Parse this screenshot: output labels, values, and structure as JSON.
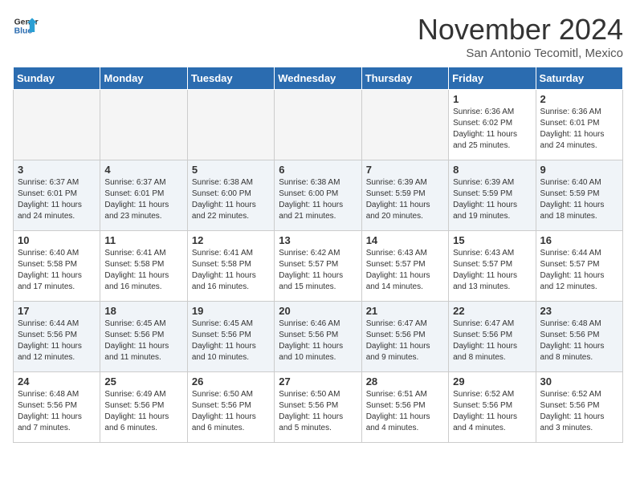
{
  "header": {
    "logo_line1": "General",
    "logo_line2": "Blue",
    "month_title": "November 2024",
    "location": "San Antonio Tecomitl, Mexico"
  },
  "weekdays": [
    "Sunday",
    "Monday",
    "Tuesday",
    "Wednesday",
    "Thursday",
    "Friday",
    "Saturday"
  ],
  "weeks": [
    [
      {
        "day": "",
        "info": ""
      },
      {
        "day": "",
        "info": ""
      },
      {
        "day": "",
        "info": ""
      },
      {
        "day": "",
        "info": ""
      },
      {
        "day": "",
        "info": ""
      },
      {
        "day": "1",
        "info": "Sunrise: 6:36 AM\nSunset: 6:02 PM\nDaylight: 11 hours\nand 25 minutes."
      },
      {
        "day": "2",
        "info": "Sunrise: 6:36 AM\nSunset: 6:01 PM\nDaylight: 11 hours\nand 24 minutes."
      }
    ],
    [
      {
        "day": "3",
        "info": "Sunrise: 6:37 AM\nSunset: 6:01 PM\nDaylight: 11 hours\nand 24 minutes."
      },
      {
        "day": "4",
        "info": "Sunrise: 6:37 AM\nSunset: 6:01 PM\nDaylight: 11 hours\nand 23 minutes."
      },
      {
        "day": "5",
        "info": "Sunrise: 6:38 AM\nSunset: 6:00 PM\nDaylight: 11 hours\nand 22 minutes."
      },
      {
        "day": "6",
        "info": "Sunrise: 6:38 AM\nSunset: 6:00 PM\nDaylight: 11 hours\nand 21 minutes."
      },
      {
        "day": "7",
        "info": "Sunrise: 6:39 AM\nSunset: 5:59 PM\nDaylight: 11 hours\nand 20 minutes."
      },
      {
        "day": "8",
        "info": "Sunrise: 6:39 AM\nSunset: 5:59 PM\nDaylight: 11 hours\nand 19 minutes."
      },
      {
        "day": "9",
        "info": "Sunrise: 6:40 AM\nSunset: 5:59 PM\nDaylight: 11 hours\nand 18 minutes."
      }
    ],
    [
      {
        "day": "10",
        "info": "Sunrise: 6:40 AM\nSunset: 5:58 PM\nDaylight: 11 hours\nand 17 minutes."
      },
      {
        "day": "11",
        "info": "Sunrise: 6:41 AM\nSunset: 5:58 PM\nDaylight: 11 hours\nand 16 minutes."
      },
      {
        "day": "12",
        "info": "Sunrise: 6:41 AM\nSunset: 5:58 PM\nDaylight: 11 hours\nand 16 minutes."
      },
      {
        "day": "13",
        "info": "Sunrise: 6:42 AM\nSunset: 5:57 PM\nDaylight: 11 hours\nand 15 minutes."
      },
      {
        "day": "14",
        "info": "Sunrise: 6:43 AM\nSunset: 5:57 PM\nDaylight: 11 hours\nand 14 minutes."
      },
      {
        "day": "15",
        "info": "Sunrise: 6:43 AM\nSunset: 5:57 PM\nDaylight: 11 hours\nand 13 minutes."
      },
      {
        "day": "16",
        "info": "Sunrise: 6:44 AM\nSunset: 5:57 PM\nDaylight: 11 hours\nand 12 minutes."
      }
    ],
    [
      {
        "day": "17",
        "info": "Sunrise: 6:44 AM\nSunset: 5:56 PM\nDaylight: 11 hours\nand 12 minutes."
      },
      {
        "day": "18",
        "info": "Sunrise: 6:45 AM\nSunset: 5:56 PM\nDaylight: 11 hours\nand 11 minutes."
      },
      {
        "day": "19",
        "info": "Sunrise: 6:45 AM\nSunset: 5:56 PM\nDaylight: 11 hours\nand 10 minutes."
      },
      {
        "day": "20",
        "info": "Sunrise: 6:46 AM\nSunset: 5:56 PM\nDaylight: 11 hours\nand 10 minutes."
      },
      {
        "day": "21",
        "info": "Sunrise: 6:47 AM\nSunset: 5:56 PM\nDaylight: 11 hours\nand 9 minutes."
      },
      {
        "day": "22",
        "info": "Sunrise: 6:47 AM\nSunset: 5:56 PM\nDaylight: 11 hours\nand 8 minutes."
      },
      {
        "day": "23",
        "info": "Sunrise: 6:48 AM\nSunset: 5:56 PM\nDaylight: 11 hours\nand 8 minutes."
      }
    ],
    [
      {
        "day": "24",
        "info": "Sunrise: 6:48 AM\nSunset: 5:56 PM\nDaylight: 11 hours\nand 7 minutes."
      },
      {
        "day": "25",
        "info": "Sunrise: 6:49 AM\nSunset: 5:56 PM\nDaylight: 11 hours\nand 6 minutes."
      },
      {
        "day": "26",
        "info": "Sunrise: 6:50 AM\nSunset: 5:56 PM\nDaylight: 11 hours\nand 6 minutes."
      },
      {
        "day": "27",
        "info": "Sunrise: 6:50 AM\nSunset: 5:56 PM\nDaylight: 11 hours\nand 5 minutes."
      },
      {
        "day": "28",
        "info": "Sunrise: 6:51 AM\nSunset: 5:56 PM\nDaylight: 11 hours\nand 4 minutes."
      },
      {
        "day": "29",
        "info": "Sunrise: 6:52 AM\nSunset: 5:56 PM\nDaylight: 11 hours\nand 4 minutes."
      },
      {
        "day": "30",
        "info": "Sunrise: 6:52 AM\nSunset: 5:56 PM\nDaylight: 11 hours\nand 3 minutes."
      }
    ]
  ]
}
